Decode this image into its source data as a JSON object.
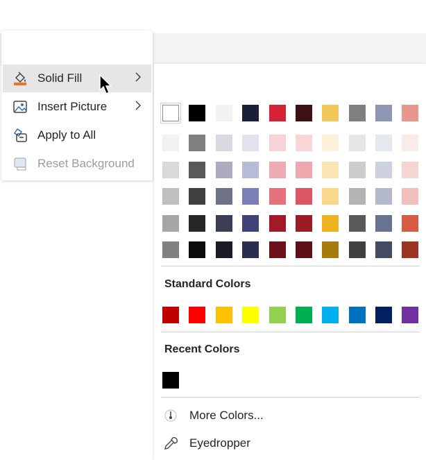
{
  "context_menu": {
    "items": [
      {
        "label": "Solid Fill",
        "icon": "paint-bucket-icon",
        "has_submenu": true,
        "enabled": true
      },
      {
        "label": "Insert Picture",
        "icon": "picture-icon",
        "has_submenu": true,
        "enabled": true
      },
      {
        "label": "Apply to All",
        "icon": "apply-to-all-icon",
        "has_submenu": false,
        "enabled": true
      },
      {
        "label": "Reset Background",
        "icon": "reset-background-icon",
        "has_submenu": false,
        "enabled": false
      }
    ]
  },
  "theme_colors": [
    [
      "#ffffff",
      "#000000",
      "#f2f2f2",
      "#1b1e37",
      "#d42236",
      "#3b1113",
      "#f3c85a",
      "#7f7f7f",
      "#8d96b2",
      "#e8978c"
    ],
    [
      "#f2f2f2",
      "#808080",
      "#d9d9e2",
      "#e3e3ef",
      "#f7d3d7",
      "#f8d6d8",
      "#fdf2d9",
      "#e6e6e6",
      "#e6e8ef",
      "#faebe8"
    ],
    [
      "#d9d9d9",
      "#595959",
      "#acacbe",
      "#b8bbd8",
      "#eeaab2",
      "#eda9ae",
      "#fbe4b3",
      "#cccccc",
      "#cdd1df",
      "#f5d5d1"
    ],
    [
      "#bfbfbf",
      "#404040",
      "#6e7289",
      "#7a7fb8",
      "#e5707e",
      "#de5564",
      "#f8d88c",
      "#b3b3b3",
      "#b4b9cc",
      "#f1c0ba"
    ],
    [
      "#a6a6a6",
      "#262626",
      "#3a3d55",
      "#3f4277",
      "#a3192a",
      "#9b1b26",
      "#efb321",
      "#595959",
      "#687391",
      "#d95b45"
    ],
    [
      "#808080",
      "#0d0d0d",
      "#1b1c28",
      "#2a2c50",
      "#6b1019",
      "#5e1019",
      "#a67c10",
      "#404040",
      "#434b63",
      "#9c3424"
    ]
  ],
  "standard_colors_title": "Standard Colors",
  "standard_colors": [
    "#c00000",
    "#ff0000",
    "#ffc000",
    "#ffff00",
    "#92d050",
    "#00b050",
    "#00b0f0",
    "#0070c0",
    "#002060",
    "#7030a0"
  ],
  "recent_colors_title": "Recent Colors",
  "recent_colors": [
    "#000000"
  ],
  "submenu_items": [
    {
      "label": "More Colors...",
      "icon": "color-wheel-icon"
    },
    {
      "label": "Eyedropper",
      "icon": "eyedropper-icon"
    }
  ]
}
